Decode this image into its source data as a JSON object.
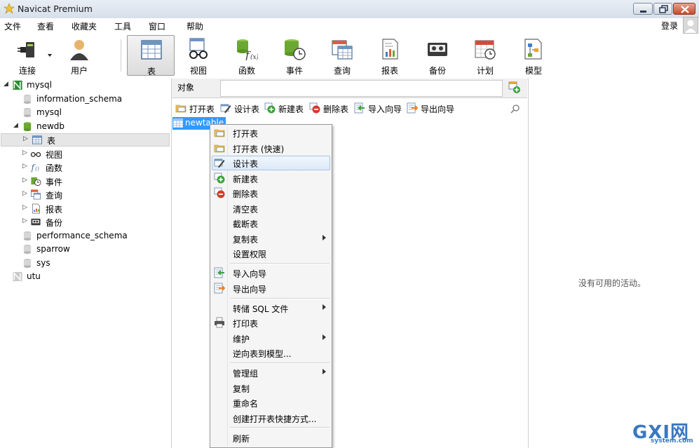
{
  "window": {
    "title": "Navicat Premium",
    "controls": {
      "minimize": "minimize",
      "maximize": "maximize",
      "close": "close"
    }
  },
  "menu": {
    "items": [
      "文件",
      "查看",
      "收藏夹",
      "工具",
      "窗口",
      "帮助"
    ],
    "login": "登录"
  },
  "toolbar": {
    "buttons": [
      {
        "id": "connect",
        "label": "连接",
        "icon": "plug-icon"
      },
      {
        "id": "user",
        "label": "用户",
        "icon": "user-icon"
      },
      {
        "id": "table",
        "label": "表",
        "icon": "table-icon",
        "active": true
      },
      {
        "id": "view",
        "label": "视图",
        "icon": "view-glasses-icon"
      },
      {
        "id": "function",
        "label": "函数",
        "icon": "function-icon"
      },
      {
        "id": "event",
        "label": "事件",
        "icon": "event-clock-icon"
      },
      {
        "id": "query",
        "label": "查询",
        "icon": "query-icon"
      },
      {
        "id": "report",
        "label": "报表",
        "icon": "report-icon"
      },
      {
        "id": "backup",
        "label": "备份",
        "icon": "backup-tape-icon"
      },
      {
        "id": "schedule",
        "label": "计划",
        "icon": "calendar-icon"
      },
      {
        "id": "model",
        "label": "模型",
        "icon": "model-icon"
      }
    ]
  },
  "tree": {
    "items": [
      {
        "label": "mysql",
        "level": 0,
        "icon": "connection-icon",
        "expanded": true
      },
      {
        "label": "information_schema",
        "level": 1,
        "icon": "database-icon"
      },
      {
        "label": "mysql",
        "level": 1,
        "icon": "database-icon"
      },
      {
        "label": "newdb",
        "level": 1,
        "icon": "database-open-icon",
        "expanded": true
      },
      {
        "label": "表",
        "level": 2,
        "icon": "table-icon",
        "selected": true
      },
      {
        "label": "视图",
        "level": 2,
        "icon": "view-glasses-icon"
      },
      {
        "label": "函数",
        "level": 2,
        "icon": "function-icon"
      },
      {
        "label": "事件",
        "level": 2,
        "icon": "event-clock-icon"
      },
      {
        "label": "查询",
        "level": 2,
        "icon": "query-icon"
      },
      {
        "label": "报表",
        "level": 2,
        "icon": "report-icon"
      },
      {
        "label": "备份",
        "level": 2,
        "icon": "backup-tape-icon"
      },
      {
        "label": "performance_schema",
        "level": 1,
        "icon": "database-icon"
      },
      {
        "label": "sparrow",
        "level": 1,
        "icon": "database-icon"
      },
      {
        "label": "sys",
        "level": 1,
        "icon": "database-icon"
      },
      {
        "label": "utu",
        "level": 0,
        "icon": "connection-closed-icon"
      }
    ]
  },
  "objects": {
    "tab": "对象",
    "actions": [
      {
        "label": "打开表",
        "icon": "open-table-icon"
      },
      {
        "label": "设计表",
        "icon": "design-table-icon"
      },
      {
        "label": "新建表",
        "icon": "new-table-icon"
      },
      {
        "label": "删除表",
        "icon": "delete-table-icon"
      },
      {
        "label": "导入向导",
        "icon": "import-icon"
      },
      {
        "label": "导出向导",
        "icon": "export-icon"
      }
    ],
    "items": [
      "newtable"
    ]
  },
  "context_menu": {
    "groups": [
      [
        {
          "label": "打开表",
          "icon": "open-table-icon"
        },
        {
          "label": "打开表 (快速)",
          "icon": "open-table-fast-icon"
        },
        {
          "label": "设计表",
          "icon": "design-table-icon",
          "hover": true
        },
        {
          "label": "新建表",
          "icon": "new-table-icon"
        },
        {
          "label": "删除表",
          "icon": "delete-table-icon"
        },
        {
          "label": "清空表"
        },
        {
          "label": "截断表"
        },
        {
          "label": "复制表",
          "submenu": true
        },
        {
          "label": "设置权限"
        }
      ],
      [
        {
          "label": "导入向导",
          "icon": "import-icon"
        },
        {
          "label": "导出向导",
          "icon": "export-icon"
        }
      ],
      [
        {
          "label": "转储 SQL 文件",
          "submenu": true
        },
        {
          "label": "打印表",
          "icon": "printer-icon"
        },
        {
          "label": "维护",
          "submenu": true
        },
        {
          "label": "逆向表到模型..."
        }
      ],
      [
        {
          "label": "管理组",
          "submenu": true
        },
        {
          "label": "复制"
        },
        {
          "label": "重命名"
        },
        {
          "label": "创建打开表快捷方式..."
        }
      ],
      [
        {
          "label": "刷新"
        }
      ]
    ]
  },
  "activity": {
    "empty_text": "没有可用的活动。"
  },
  "watermark": {
    "brand": "GXI网",
    "site": "system.com"
  }
}
